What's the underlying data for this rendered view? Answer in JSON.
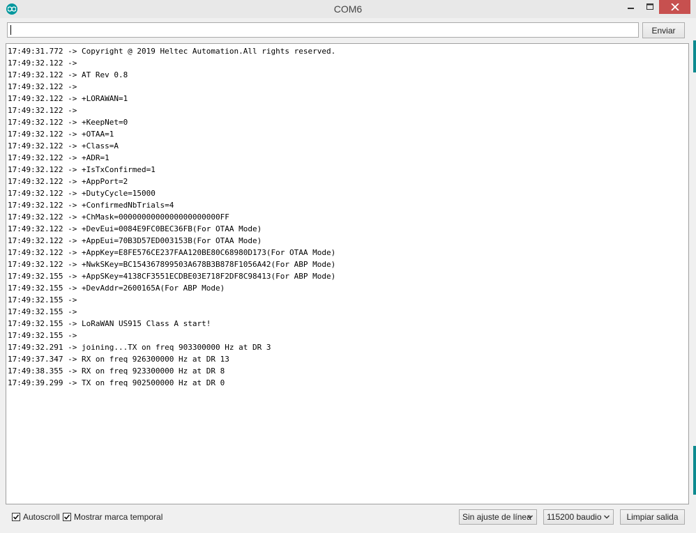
{
  "window": {
    "title": "COM6",
    "accent": "#00979d",
    "close_color": "#c7504f"
  },
  "send": {
    "input_value": "",
    "button_label": "Enviar"
  },
  "output": {
    "lines": [
      "17:49:31.772 -> Copyright @ 2019 Heltec Automation.All rights reserved.",
      "17:49:32.122 -> ",
      "17:49:32.122 -> AT Rev 0.8",
      "17:49:32.122 -> ",
      "17:49:32.122 -> +LORAWAN=1",
      "17:49:32.122 -> ",
      "17:49:32.122 -> +KeepNet=0",
      "17:49:32.122 -> +OTAA=1",
      "17:49:32.122 -> +Class=A",
      "17:49:32.122 -> +ADR=1",
      "17:49:32.122 -> +IsTxConfirmed=1",
      "17:49:32.122 -> +AppPort=2",
      "17:49:32.122 -> +DutyCycle=15000",
      "17:49:32.122 -> +ConfirmedNbTrials=4",
      "17:49:32.122 -> +ChMask=0000000000000000000000FF",
      "17:49:32.122 -> +DevEui=0084E9FC0BEC36FB(For OTAA Mode)",
      "17:49:32.122 -> +AppEui=70B3D57ED003153B(For OTAA Mode)",
      "17:49:32.122 -> +AppKey=E8FE576CE237FAA120BE80C68980D173(For OTAA Mode)",
      "17:49:32.122 -> +NwkSKey=BC154367899503A678B3B878F1056A42(For ABP Mode)",
      "17:49:32.155 -> +AppSKey=4138CF3551ECDBE03E718F2DF8C98413(For ABP Mode)",
      "17:49:32.155 -> +DevAddr=2600165A(For ABP Mode)",
      "17:49:32.155 -> ",
      "17:49:32.155 -> ",
      "17:49:32.155 -> LoRaWAN US915 Class A start!",
      "17:49:32.155 -> ",
      "17:49:32.291 -> joining...TX on freq 903300000 Hz at DR 3",
      "17:49:37.347 -> RX on freq 926300000 Hz at DR 13",
      "17:49:38.355 -> RX on freq 923300000 Hz at DR 8",
      "17:49:39.299 -> TX on freq 902500000 Hz at DR 0"
    ]
  },
  "bottom": {
    "autoscroll_label": "Autoscroll",
    "autoscroll_checked": true,
    "timestamp_label": "Mostrar marca temporal",
    "timestamp_checked": true,
    "line_ending_value": "Sin ajuste de línea",
    "baud_value": "115200 baudio",
    "clear_label": "Limpiar salida"
  }
}
